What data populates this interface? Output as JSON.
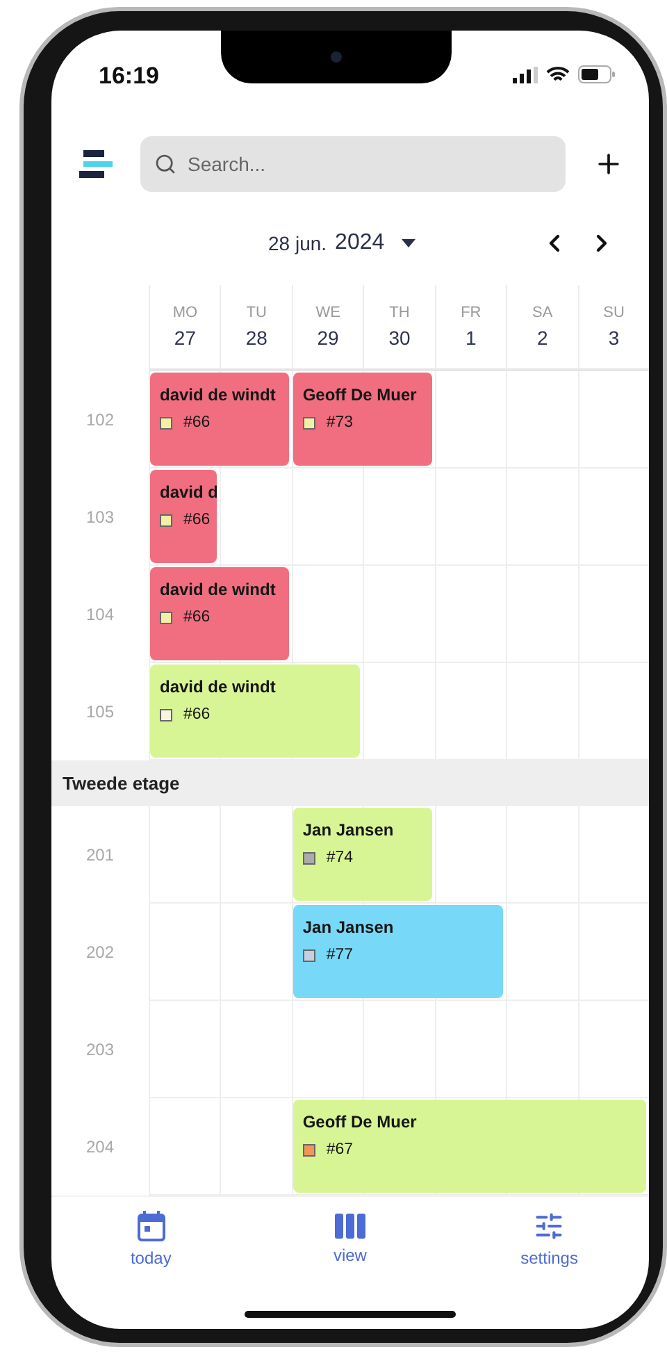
{
  "status_bar": {
    "time": "16:19"
  },
  "search": {
    "placeholder": "Search..."
  },
  "date": {
    "day": "28 jun.",
    "year": "2024"
  },
  "days": [
    {
      "name": "MO",
      "number": "27"
    },
    {
      "name": "TU",
      "number": "28"
    },
    {
      "name": "WE",
      "number": "29"
    },
    {
      "name": "TH",
      "number": "30"
    },
    {
      "name": "FR",
      "number": "1"
    },
    {
      "name": "SA",
      "number": "2"
    },
    {
      "name": "SU",
      "number": "3"
    }
  ],
  "sections": [
    {
      "rooms": [
        {
          "label": "102",
          "slots": [
            {
              "kind": "booking",
              "guest": "david de windt",
              "code": "#66",
              "color": "#f06e80",
              "tag": {
                "color": "#f2efa6"
              }
            },
            {
              "kind": "cont"
            },
            {
              "kind": "booking",
              "guest": "Geoff De Muer",
              "code": "#73",
              "color": "#f06e80",
              "tag": {
                "color": "#f2efa6"
              }
            },
            {
              "kind": "cont"
            },
            {
              "kind": "free"
            },
            {
              "kind": "free"
            },
            {
              "kind": "free"
            }
          ]
        },
        {
          "label": "103",
          "slots": [
            {
              "kind": "booking",
              "guest": "david d",
              "code": "#66",
              "color": "#f06e80",
              "tag": {
                "color": "#f2efa6"
              }
            },
            {
              "kind": "free"
            },
            {
              "kind": "free"
            },
            {
              "kind": "free"
            },
            {
              "kind": "free"
            },
            {
              "kind": "free"
            },
            {
              "kind": "free"
            }
          ]
        },
        {
          "label": "104",
          "slots": [
            {
              "kind": "booking",
              "guest": "david de windt",
              "code": "#66",
              "color": "#f06e80",
              "tag": {
                "color": "#f2efa6"
              }
            },
            {
              "kind": "cont"
            },
            {
              "kind": "free"
            },
            {
              "kind": "free"
            },
            {
              "kind": "free"
            },
            {
              "kind": "free"
            },
            {
              "kind": "free"
            }
          ]
        },
        {
          "label": "105",
          "slots": [
            {
              "kind": "booking",
              "guest": "david de windt",
              "code": "#66",
              "color": "#d8f595",
              "tag": {
                "color": "#f7f5e0"
              }
            },
            {
              "kind": "cont"
            },
            {
              "kind": "cont"
            },
            {
              "kind": "free"
            },
            {
              "kind": "free"
            },
            {
              "kind": "free"
            },
            {
              "kind": "free"
            }
          ]
        }
      ]
    },
    {
      "title": "Tweede etage",
      "rooms": [
        {
          "label": "201",
          "slots": [
            {
              "kind": "free"
            },
            {
              "kind": "free"
            },
            {
              "kind": "booking",
              "guest": "Jan Jansen",
              "code": "#74",
              "color": "#d8f595",
              "tag": {
                "color": "#ababab"
              }
            },
            {
              "kind": "cont"
            },
            {
              "kind": "free"
            },
            {
              "kind": "free"
            },
            {
              "kind": "free"
            }
          ]
        },
        {
          "label": "202",
          "slots": [
            {
              "kind": "free"
            },
            {
              "kind": "free"
            },
            {
              "kind": "booking",
              "guest": "Jan Jansen",
              "code": "#77",
              "color": "#78d8f7",
              "tag": {
                "color": "#c5cfe0"
              }
            },
            {
              "kind": "cont"
            },
            {
              "kind": "cont"
            },
            {
              "kind": "free"
            },
            {
              "kind": "free"
            }
          ]
        },
        {
          "label": "203",
          "slots": [
            {
              "kind": "free"
            },
            {
              "kind": "free"
            },
            {
              "kind": "free"
            },
            {
              "kind": "free"
            },
            {
              "kind": "free"
            },
            {
              "kind": "free"
            },
            {
              "kind": "free"
            }
          ]
        },
        {
          "label": "204",
          "slots": [
            {
              "kind": "free"
            },
            {
              "kind": "free"
            },
            {
              "kind": "booking",
              "guest": "Geoff De Muer",
              "code": "#67",
              "color": "#d8f595",
              "tag": {
                "color": "#f0965a"
              }
            },
            {
              "kind": "cont"
            },
            {
              "kind": "cont"
            },
            {
              "kind": "cont"
            },
            {
              "kind": "cont"
            }
          ]
        }
      ]
    }
  ],
  "nav": [
    {
      "kind": "today",
      "label": "today"
    },
    {
      "kind": "view",
      "label": "view"
    },
    {
      "kind": "settings",
      "label": "settings"
    }
  ]
}
